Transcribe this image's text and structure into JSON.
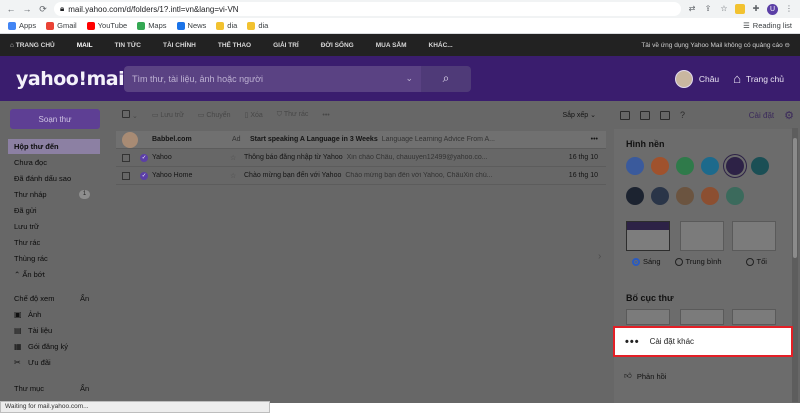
{
  "browser": {
    "url": "mail.yahoo.com/d/folders/1?.intl=vn&lang=vi-VN",
    "bookmarks": [
      "Apps",
      "Gmail",
      "YouTube",
      "Maps",
      "News",
      "dia",
      "dia"
    ],
    "reading_list": "Reading list",
    "profile_initial": "U",
    "status_text": "Waiting for mail.yahoo.com..."
  },
  "topnav": {
    "items": [
      "TRANG CHỦ",
      "MAIL",
      "TIN TỨC",
      "TÀI CHÍNH",
      "THỂ THAO",
      "GIẢI TRÍ",
      "ĐỜI SỐNG",
      "MUA SẮM",
      "KHÁC..."
    ],
    "right_text": "Tải về ứng dụng Yahoo Mail không có quảng cáo ⊖"
  },
  "header": {
    "logo": "yahoo!mail",
    "search_placeholder": "Tìm thư, tài liệu, ảnh hoặc người",
    "user_name": "Châu",
    "home_label": "Trang chủ"
  },
  "sidebar": {
    "compose": "Soạn thư",
    "items": [
      {
        "label": "Hộp thư đến",
        "count": ""
      },
      {
        "label": "Chưa đọc",
        "count": ""
      },
      {
        "label": "Đã đánh dấu sao",
        "count": ""
      },
      {
        "label": "Thư nháp",
        "count": "1"
      },
      {
        "label": "Đã gửi",
        "count": ""
      },
      {
        "label": "Lưu trữ",
        "count": ""
      },
      {
        "label": "Thư rác",
        "count": ""
      },
      {
        "label": "Thùng rác",
        "count": ""
      },
      {
        "label": "⌃ Ẩn bớt",
        "count": ""
      }
    ],
    "views_label": "Chế độ xem",
    "views_hide": "Ẩn",
    "views": [
      "Ảnh",
      "Tài liệu",
      "Gói đăng ký",
      "Ưu đãi"
    ],
    "folders_label": "Thư mục",
    "folders_hide": "Ẩn"
  },
  "toolbar": {
    "actions": [
      "Lưu trữ",
      "Chuyển",
      "Xóa",
      "Thư rác",
      "•••"
    ],
    "sort": "Sắp xếp ⌄"
  },
  "messages": [
    {
      "sender": "Babbel.com",
      "ad": "Ad",
      "subject": "Start speaking A Language in 3 Weeks",
      "preview": "Language Learning Advice From A...",
      "date": "",
      "more": "•••"
    },
    {
      "sender": "Yahoo",
      "ad": "",
      "subject": "Thông báo đăng nhập từ Yahoo",
      "preview": "Xin chào Châu, chauuyen12499@yahoo.co...",
      "date": "16 thg 10",
      "more": ""
    },
    {
      "sender": "Yahoo Home",
      "ad": "",
      "subject": "Chào mừng bạn đến với Yahoo",
      "preview": "Chào mừng bạn đến với Yahoo, ChâuXin chú...",
      "date": "16 thg 10",
      "more": ""
    }
  ],
  "settings": {
    "label": "Cài đặt",
    "theme_title": "Hình nền",
    "swatches_row1": [
      "#3a68c4",
      "#e06a2a",
      "#2ea35a",
      "#1787b8",
      "#3d2a6b",
      "#1d6b74"
    ],
    "swatches_row2": [
      "#1f2a3a",
      "#33425c",
      "#8a6b4a",
      "#c06a3b",
      "#4a8a79"
    ],
    "modes": [
      "Sáng",
      "Trung bình",
      "Tối"
    ],
    "layout_title": "Bố cục thư",
    "more_settings": "Cài đặt khác",
    "feedback": "Phản hồi"
  }
}
